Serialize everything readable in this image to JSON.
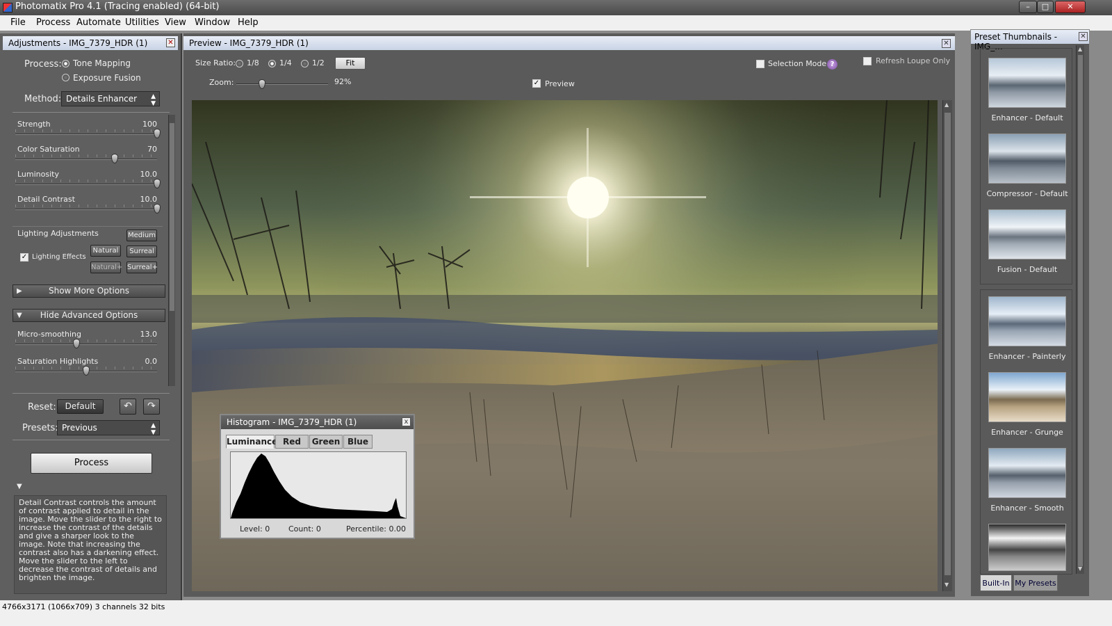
{
  "window": {
    "title": "Photomatix Pro 4.1 (Tracing enabled) (64-bit)",
    "minimize": "–",
    "maximize": "□",
    "close": "✕"
  },
  "menu": {
    "file": "File",
    "process": "Process",
    "automate": "Automate",
    "utilities": "Utilities",
    "view": "View",
    "window": "Window",
    "help": "Help"
  },
  "adjustments": {
    "title": "Adjustments - IMG_7379_HDR (1)",
    "process_label": "Process:",
    "tone_mapping": "Tone Mapping",
    "exposure_fusion": "Exposure Fusion",
    "process_selected": "Tone Mapping",
    "method_label": "Method:",
    "method_value": "Details Enhancer",
    "sliders": [
      {
        "label": "Strength",
        "value": "100",
        "fraction": 1.0
      },
      {
        "label": "Color Saturation",
        "value": "70",
        "fraction": 0.7
      },
      {
        "label": "Luminosity",
        "value": "10.0",
        "fraction": 1.0
      },
      {
        "label": "Detail Contrast",
        "value": "10.0",
        "fraction": 1.0
      }
    ],
    "lighting_label": "Lighting Adjustments",
    "lighting_effects": "Lighting Effects",
    "lighting_effects_checked": true,
    "btn_medium": "Medium",
    "btn_natural": "Natural",
    "btn_surreal": "Surreal",
    "btn_natural_plus": "Natural+",
    "btn_surreal_plus": "Surreal+",
    "show_more": "Show More Options",
    "hide_advanced": "Hide Advanced Options",
    "adv_sliders": [
      {
        "label": "Micro-smoothing",
        "value": "13.0",
        "fraction": 0.43
      },
      {
        "label": "Saturation Highlights",
        "value": "0.0",
        "fraction": 0.5
      }
    ],
    "reset_label": "Reset:",
    "default_btn": "Default",
    "presets_label": "Presets:",
    "presets_value": "Previous",
    "process_btn": "Process",
    "description": "Detail Contrast controls the amount of contrast applied to detail in the image. Move the slider to the right to increase the contrast of the details and give a sharper look to the image. Note that increasing the contrast also has a darkening effect. Move the slider to the left to decrease the contrast of details and brighten the image."
  },
  "preview": {
    "title": "Preview - IMG_7379_HDR (1)",
    "size_ratio_label": "Size Ratio:",
    "r18": "1/8",
    "r14": "1/4",
    "r12": "1/2",
    "ratio_selected": "1/4",
    "fit": "Fit",
    "zoom_label": "Zoom:",
    "zoom_value": "92%",
    "zoom_fraction": 0.28,
    "preview_chk": "Preview",
    "preview_checked": true,
    "selection_mode": "Selection Mode",
    "help": "?",
    "refresh_loupe": "Refresh Loupe Only"
  },
  "histogram": {
    "title": "Histogram - IMG_7379_HDR (1)",
    "tabs": [
      "Luminance",
      "Red",
      "Green",
      "Blue"
    ],
    "active_tab": "Luminance",
    "level": "Level: 0",
    "count": "Count: 0",
    "percentile": "Percentile: 0.00",
    "close": "x"
  },
  "presets_panel": {
    "title": "Preset Thumbnails - IMG_...",
    "group1": [
      "Enhancer - Default",
      "Compressor - Default",
      "Fusion - Default"
    ],
    "group2": [
      "Enhancer - Painterly",
      "Enhancer - Grunge",
      "Enhancer - Smooth"
    ],
    "tab_builtin": "Built-In",
    "tab_mypresets": "My Presets"
  },
  "status": {
    "text": "4766x3171 (1066x709) 3 channels 32 bits"
  }
}
